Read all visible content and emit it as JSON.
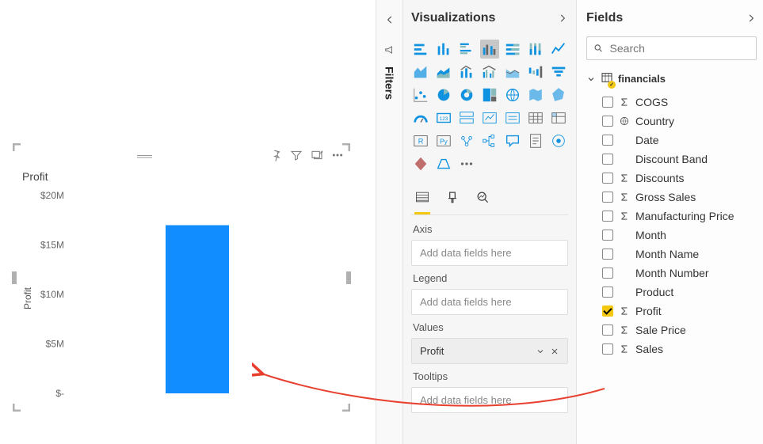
{
  "chart_data": {
    "type": "bar",
    "title": "Profit",
    "ylabel": "Profit",
    "xlabel": "",
    "ylim": [
      0,
      20000000
    ],
    "yticks": [
      {
        "value": 0,
        "label": "$-"
      },
      {
        "value": 5000000,
        "label": "$5M"
      },
      {
        "value": 10000000,
        "label": "$10M"
      },
      {
        "value": 15000000,
        "label": "$15M"
      },
      {
        "value": 20000000,
        "label": "$20M"
      }
    ],
    "categories": [
      ""
    ],
    "values": [
      17000000
    ]
  },
  "accent_color": "#118dff",
  "filters_tab": {
    "label": "Filters"
  },
  "viz_pane": {
    "title": "Visualizations",
    "wells": {
      "axis": {
        "label": "Axis",
        "placeholder": "Add data fields here"
      },
      "legend": {
        "label": "Legend",
        "placeholder": "Add data fields here"
      },
      "values": {
        "label": "Values",
        "item": "Profit"
      },
      "tooltips": {
        "label": "Tooltips",
        "placeholder": "Add data fields here"
      }
    }
  },
  "fields_pane": {
    "title": "Fields",
    "search_placeholder": "Search",
    "table": {
      "name": "financials",
      "fields": [
        {
          "name": "COGS",
          "type": "sum",
          "checked": false
        },
        {
          "name": "Country",
          "type": "geo",
          "checked": false
        },
        {
          "name": "Date",
          "type": "plain",
          "checked": false
        },
        {
          "name": "Discount Band",
          "type": "plain",
          "checked": false
        },
        {
          "name": "Discounts",
          "type": "sum",
          "checked": false
        },
        {
          "name": "Gross Sales",
          "type": "sum",
          "checked": false
        },
        {
          "name": "Manufacturing Price",
          "type": "sum",
          "checked": false
        },
        {
          "name": "Month",
          "type": "plain",
          "checked": false
        },
        {
          "name": "Month Name",
          "type": "plain",
          "checked": false
        },
        {
          "name": "Month Number",
          "type": "plain",
          "checked": false
        },
        {
          "name": "Product",
          "type": "plain",
          "checked": false
        },
        {
          "name": "Profit",
          "type": "sum",
          "checked": true
        },
        {
          "name": "Sale Price",
          "type": "sum",
          "checked": false
        },
        {
          "name": "Sales",
          "type": "sum",
          "checked": false
        }
      ]
    }
  }
}
